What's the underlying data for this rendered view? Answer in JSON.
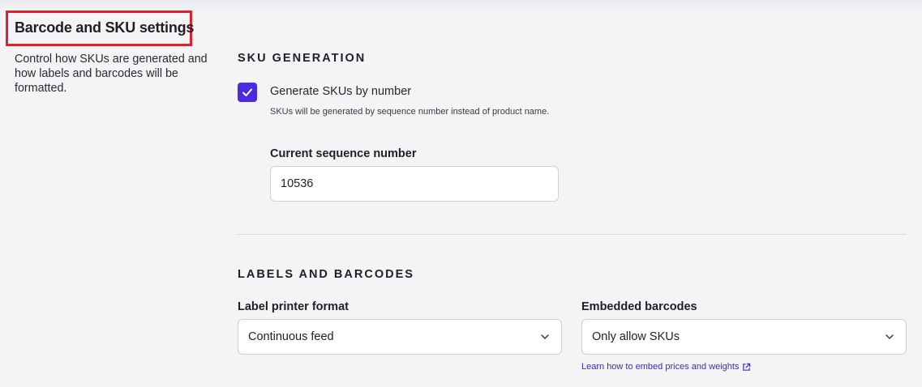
{
  "section": {
    "title": "Barcode and SKU settings",
    "description": "Control how SKUs are generated and how labels and barcodes will be formatted."
  },
  "sku_generation": {
    "heading": "SKU GENERATION",
    "checkbox_label": "Generate SKUs by number",
    "checkbox_checked": true,
    "checkbox_help": "SKUs will be generated by sequence number instead of product name.",
    "sequence_label": "Current sequence number",
    "sequence_value": "10536"
  },
  "labels_barcodes": {
    "heading": "LABELS AND BARCODES",
    "printer_format_label": "Label printer format",
    "printer_format_value": "Continuous feed",
    "embedded_label": "Embedded barcodes",
    "embedded_value": "Only allow SKUs",
    "help_link": "Learn how to embed prices and weights"
  },
  "colors": {
    "accent": "#4a2be0",
    "highlight_border": "#e0202a",
    "link": "#3a2bc4"
  },
  "icons": [
    "checkmark-icon",
    "chevron-down-icon",
    "external-link-icon"
  ]
}
